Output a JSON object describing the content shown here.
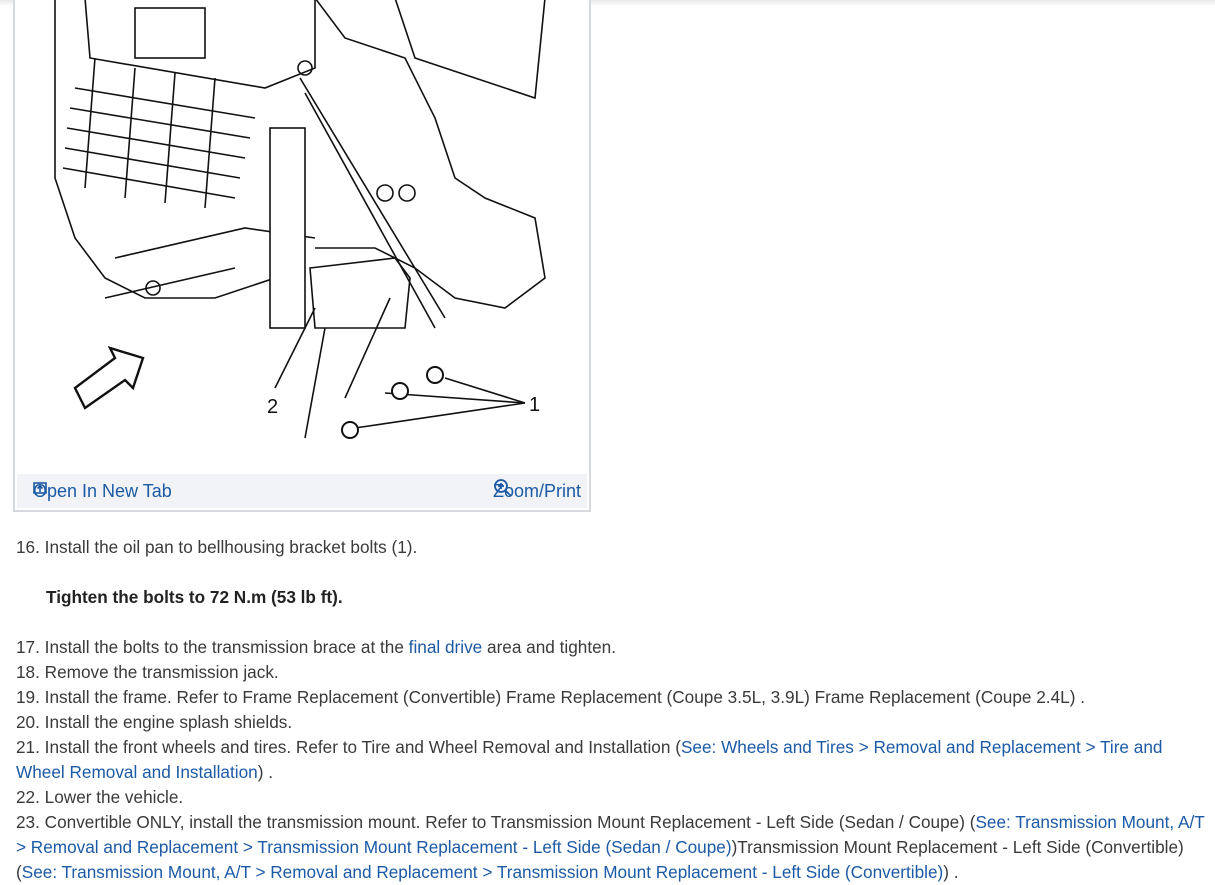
{
  "figure": {
    "callouts": [
      "1",
      "2"
    ],
    "open_tab": "Open In New Tab",
    "zoom_print": "Zoom/Print",
    "link_color": "#1c5aa6"
  },
  "steps": {
    "s16": "16. Install the oil pan to bellhousing bracket bolts (1).",
    "s16_note": "Tighten the bolts to 72 N.m (53 lb ft).",
    "s17a": "17. Install the bolts to the transmission brace at the ",
    "s17link": "final drive",
    "s17b": " area and tighten.",
    "s18": "18. Remove the transmission jack.",
    "s19": "19. Install the frame. Refer to Frame Replacement (Convertible) Frame Replacement (Coupe 3.5L, 3.9L) Frame Replacement (Coupe 2.4L) .",
    "s20": "20. Install the engine splash shields.",
    "s21a": "21. Install the front wheels and tires. Refer to Tire and Wheel Removal and Installation (",
    "s21link": "See: Wheels and Tires > Removal and Replacement > Tire and Wheel Removal and Installation",
    "s21b": ") .",
    "s22": "22. Lower the vehicle.",
    "s23a": "23. Convertible ONLY, install the transmission mount. Refer to Transmission Mount Replacement - Left Side (Sedan / Coupe) (",
    "s23link1": "See: Transmission Mount, A/T > Removal and Replacement > Transmission Mount Replacement - Left Side (Sedan / Coupe)",
    "s23b": ")Transmission Mount Replacement - Left Side (Convertible) (",
    "s23link2": "See: Transmission Mount, A/T > Removal and Replacement > Transmission Mount Replacement - Left Side (Convertible)",
    "s23c": ") ."
  }
}
